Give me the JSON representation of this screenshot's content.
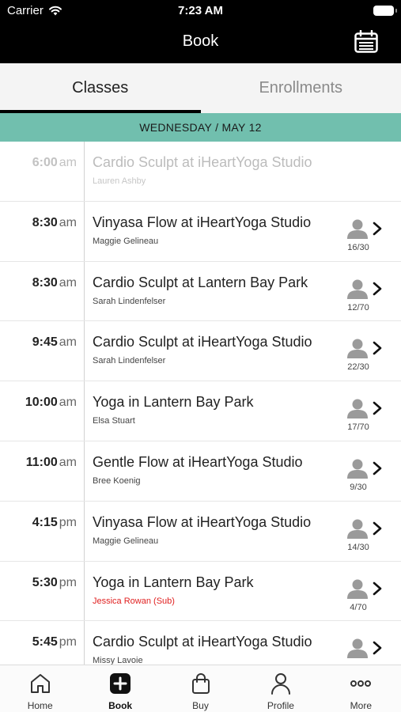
{
  "status_bar": {
    "carrier": "Carrier",
    "time": "7:23 AM"
  },
  "header": {
    "title": "Book",
    "calendar_icon": "calendar-icon"
  },
  "tabs": [
    {
      "label": "Classes",
      "active": true
    },
    {
      "label": "Enrollments",
      "active": false
    }
  ],
  "date_header": "WEDNESDAY / MAY 12",
  "classes": [
    {
      "time": "6:00",
      "ampm": "am",
      "name": "Cardio Sculpt at iHeartYoga Studio",
      "instructor": "Lauren Ashby",
      "capacity": "",
      "past": true,
      "sub": false
    },
    {
      "time": "8:30",
      "ampm": "am",
      "name": "Vinyasa Flow at iHeartYoga Studio",
      "instructor": "Maggie Gelineau",
      "capacity": "16/30",
      "past": false,
      "sub": false
    },
    {
      "time": "8:30",
      "ampm": "am",
      "name": "Cardio Sculpt at Lantern Bay Park",
      "instructor": "Sarah Lindenfelser",
      "capacity": "12/70",
      "past": false,
      "sub": false
    },
    {
      "time": "9:45",
      "ampm": "am",
      "name": "Cardio Sculpt at iHeartYoga Studio",
      "instructor": "Sarah Lindenfelser",
      "capacity": "22/30",
      "past": false,
      "sub": false
    },
    {
      "time": "10:00",
      "ampm": "am",
      "name": "Yoga in Lantern Bay Park",
      "instructor": "Elsa Stuart",
      "capacity": "17/70",
      "past": false,
      "sub": false
    },
    {
      "time": "11:00",
      "ampm": "am",
      "name": "Gentle Flow at iHeartYoga Studio",
      "instructor": "Bree Koenig",
      "capacity": "9/30",
      "past": false,
      "sub": false
    },
    {
      "time": "4:15",
      "ampm": "pm",
      "name": "Vinyasa Flow at iHeartYoga Studio",
      "instructor": "Maggie Gelineau",
      "capacity": "14/30",
      "past": false,
      "sub": false
    },
    {
      "time": "5:30",
      "ampm": "pm",
      "name": "Yoga in Lantern Bay Park",
      "instructor": "Jessica Rowan (Sub)",
      "capacity": "4/70",
      "past": false,
      "sub": true
    },
    {
      "time": "5:45",
      "ampm": "pm",
      "name": "Cardio Sculpt at iHeartYoga Studio",
      "instructor": "Missy Lavoie",
      "capacity": "",
      "past": false,
      "sub": false
    }
  ],
  "bottom_tabs": [
    {
      "label": "Home",
      "icon": "home-icon",
      "active": false
    },
    {
      "label": "Book",
      "icon": "plus-icon",
      "active": true
    },
    {
      "label": "Buy",
      "icon": "shopping-bag-icon",
      "active": false
    },
    {
      "label": "Profile",
      "icon": "person-icon",
      "active": false
    },
    {
      "label": "More",
      "icon": "more-dots-icon",
      "active": false
    }
  ],
  "colors": {
    "accent": "#71bfae",
    "header_bg": "#000000",
    "sub_text": "#e02020"
  }
}
